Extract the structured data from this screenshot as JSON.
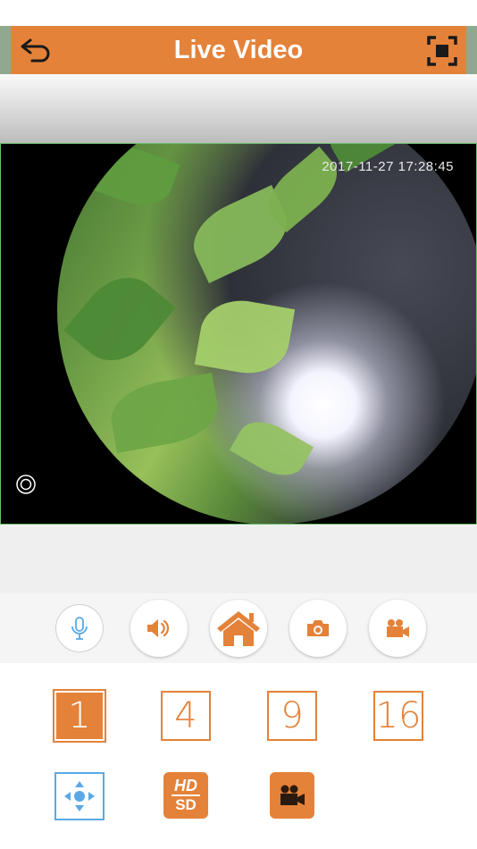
{
  "header": {
    "title": "Live Video",
    "back_icon": "undo-arrow-icon",
    "fullscreen_icon": "fullscreen-icon"
  },
  "video": {
    "timestamp": "2017-11-27 17:28:45",
    "ptz_indicator_icon": "target-ring-icon"
  },
  "toolbar": {
    "buttons": [
      "microphone-icon",
      "speaker-icon",
      "home-icon",
      "camera-icon",
      "video-camera-icon"
    ]
  },
  "grid": {
    "options": [
      "1",
      "4",
      "9",
      "16"
    ],
    "selected": "1"
  },
  "bottom": {
    "hd_label": "HD",
    "sd_label": "SD"
  },
  "colors": {
    "accent": "#e4823a",
    "ptz_blue": "#5aa9e6",
    "frame_border": "#6cbf6c"
  }
}
